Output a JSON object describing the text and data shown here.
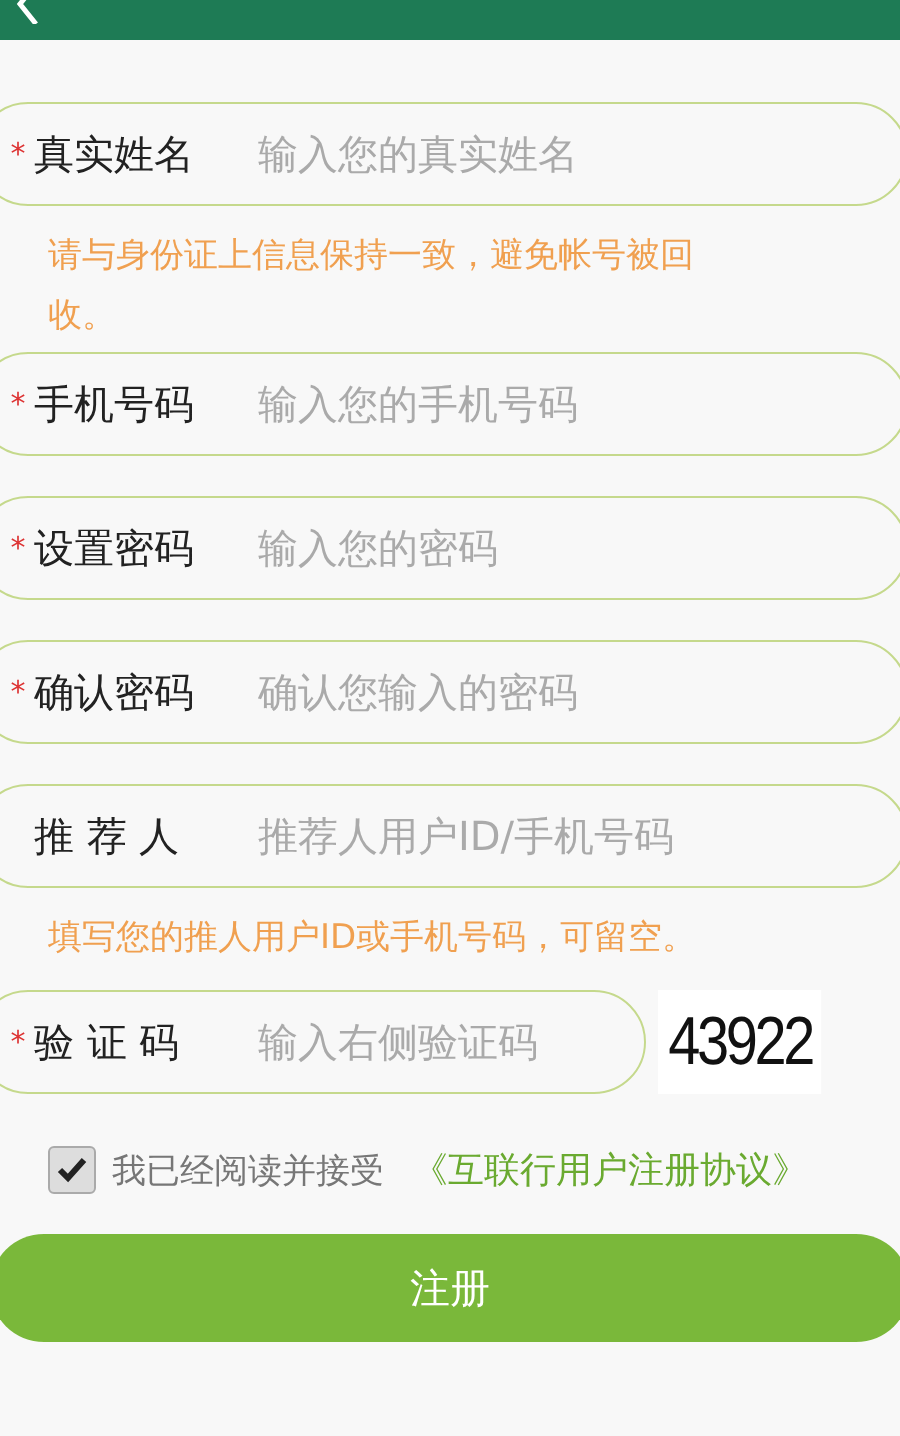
{
  "header": {
    "back": true
  },
  "required_mark": "*",
  "fields": [
    {
      "label": "真实姓名",
      "placeholder": "输入您的真实姓名",
      "required": true,
      "hint": "请与身份证上信息保持一致，避免帐号被回收。"
    },
    {
      "label": "手机号码",
      "placeholder": "输入您的手机号码",
      "required": true
    },
    {
      "label": "设置密码",
      "placeholder": "输入您的密码",
      "required": true
    },
    {
      "label": "确认密码",
      "placeholder": "确认您输入的密码",
      "required": true
    },
    {
      "label": "推 荐 人",
      "placeholder": "推荐人用户ID/手机号码",
      "required": false,
      "hint": "填写您的推人用户ID或手机号码，可留空。"
    }
  ],
  "captcha": {
    "label": "验 证 码",
    "placeholder": "输入右侧验证码",
    "required": true,
    "code": "43922"
  },
  "agreement": {
    "checked": true,
    "text": "我已经阅读并接受",
    "link": "《互联行用户注册协议》"
  },
  "submit": "注册"
}
